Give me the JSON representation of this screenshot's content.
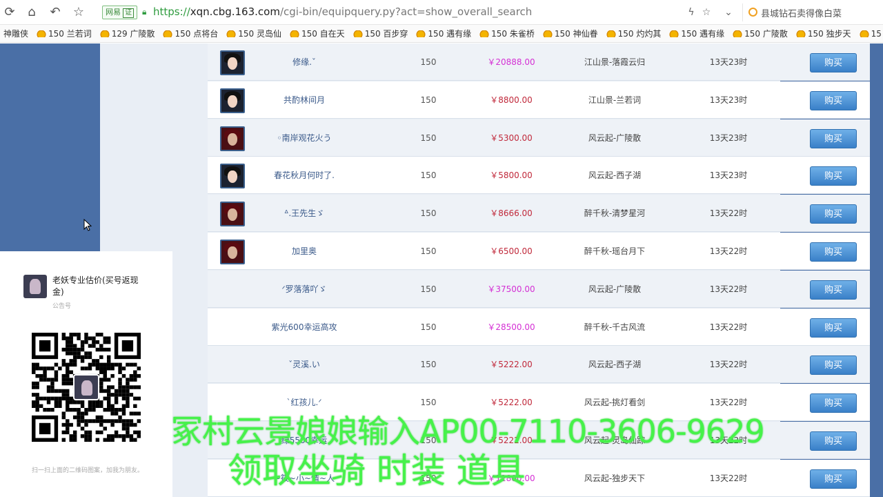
{
  "browser": {
    "security_badge": "网易",
    "security_tag": "证",
    "url_scheme": "https://",
    "url_host": "xqn.cbg.163.com",
    "url_path": "/cgi-bin/equipquery.py?act=show_overall_search",
    "search_text": "县城钻石卖得像白菜"
  },
  "bookmarks": [
    {
      "label": "神雕侠",
      "icon": false
    },
    {
      "label": "150 兰若词",
      "icon": true
    },
    {
      "label": "129 广陵散",
      "icon": true
    },
    {
      "label": "150 点将台",
      "icon": true
    },
    {
      "label": "150 灵岛仙",
      "icon": true
    },
    {
      "label": "150 自在天",
      "icon": true
    },
    {
      "label": "150 百步穿",
      "icon": true
    },
    {
      "label": "150 遇有缘",
      "icon": true
    },
    {
      "label": "150 朱雀桥",
      "icon": true
    },
    {
      "label": "150 神仙眷",
      "icon": true
    },
    {
      "label": "150 灼灼其",
      "icon": true
    },
    {
      "label": "150 遇有缘",
      "icon": true
    },
    {
      "label": "150 广陵散",
      "icon": true
    },
    {
      "label": "150 独步天",
      "icon": true
    },
    {
      "label": "15",
      "icon": true
    }
  ],
  "listings": [
    {
      "name": "修缘.ˇ",
      "level": "150",
      "price": "￥20888.00",
      "price_color": "pink",
      "server": "江山景-落霞云归",
      "time": "13天23时",
      "avatar": "dark"
    },
    {
      "name": "共酌林间月",
      "level": "150",
      "price": "￥8800.00",
      "price_color": "red",
      "server": "江山景-兰若词",
      "time": "13天23时",
      "avatar": "dark"
    },
    {
      "name": "◦南岸观花火う",
      "level": "150",
      "price": "￥5300.00",
      "price_color": "red",
      "server": "风云起-广陵散",
      "time": "13天23时",
      "avatar": "red"
    },
    {
      "name": "春花秋月何时了.",
      "level": "150",
      "price": "￥5800.00",
      "price_color": "red",
      "server": "风云起-西子湖",
      "time": "13天23时",
      "avatar": "dark"
    },
    {
      "name": "ᐞ.王先生ゞ",
      "level": "150",
      "price": "￥8666.00",
      "price_color": "red",
      "server": "醉千秋-清梦星河",
      "time": "13天22时",
      "avatar": "red"
    },
    {
      "name": "加里奥",
      "level": "150",
      "price": "￥6500.00",
      "price_color": "red",
      "server": "醉千秋-瑶台月下",
      "time": "13天22时",
      "avatar": "red"
    },
    {
      "name": "ᐟ罗落落吖ゞ",
      "level": "150",
      "price": "￥37500.00",
      "price_color": "pink",
      "server": "风云起-广陵散",
      "time": "13天22时",
      "avatar": "none"
    },
    {
      "name": "紫光600幸运高攻",
      "level": "150",
      "price": "￥28500.00",
      "price_color": "pink",
      "server": "醉千秋-千古风流",
      "time": "13天22时",
      "avatar": "none"
    },
    {
      "name": "ˇ灵溪.い",
      "level": "150",
      "price": "￥5222.00",
      "price_color": "red",
      "server": "风云起-西子湖",
      "time": "13天22时",
      "avatar": "none"
    },
    {
      "name": "ˋ红孩儿.ᐟ",
      "level": "150",
      "price": "￥5222.00",
      "price_color": "red",
      "server": "风云起-挑灯看剑",
      "time": "13天22时",
      "avatar": "none"
    },
    {
      "name": "绿5500幸运",
      "level": "150",
      "price": "￥5222.00",
      "price_color": "red",
      "server": "风云起-灵岛仙踪",
      "time": "13天22时",
      "avatar": "none"
    },
    {
      "name": "~筱~小~情~人",
      "level": "150",
      "price": "￥12800.00",
      "price_color": "pink",
      "server": "风云起-独步天下",
      "time": "13天22时",
      "avatar": "none"
    }
  ],
  "buy_label": "购买",
  "ad": {
    "title": "老妖专业估价(买号返现金)",
    "subtitle": "公告号",
    "footer": "扫一扫上面的二维码图案，加我为朋友。"
  },
  "overlay": {
    "line1": "冢村云景娘娘输入AP00-7110-3606-9629",
    "line2": "领取坐骑 时装 道具"
  }
}
